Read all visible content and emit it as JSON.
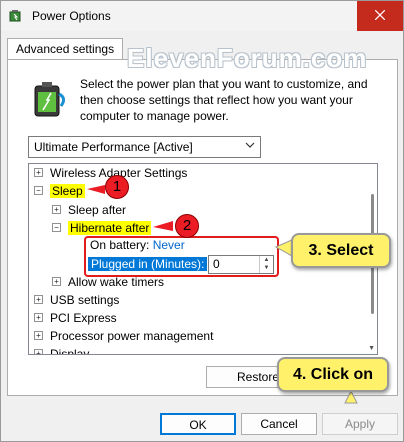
{
  "window": {
    "title": "Power Options"
  },
  "tabs": {
    "advanced": "Advanced settings"
  },
  "watermark": "ElevenForum.com",
  "intro": "Select the power plan that you want to customize, and then choose settings that reflect how you want your computer to manage power.",
  "plan": {
    "selected": "Ultimate Performance [Active]"
  },
  "tree": {
    "wireless": "Wireless Adapter Settings",
    "sleep": "Sleep",
    "sleep_after": "Sleep after",
    "hibernate_after": "Hibernate after",
    "on_battery_label": "On battery:",
    "on_battery_value": "Never",
    "plugged_in_label": "Plugged in (Minutes):",
    "plugged_in_value": "0",
    "allow_wake": "Allow wake timers",
    "usb": "USB settings",
    "pci": "PCI Express",
    "processor": "Processor power management",
    "display": "Display"
  },
  "buttons": {
    "restore": "Restore",
    "ok": "OK",
    "cancel": "Cancel",
    "apply": "Apply"
  },
  "annotations": {
    "badge1": "1",
    "badge2": "2",
    "step3": "3. Select",
    "step4": "4. Click on"
  },
  "colors": {
    "highlight": "#ffff00",
    "selection": "#0078d7",
    "annotation_red": "#ec1c24",
    "callout_yellow": "#fff26a",
    "close_red": "#c42b1c"
  }
}
